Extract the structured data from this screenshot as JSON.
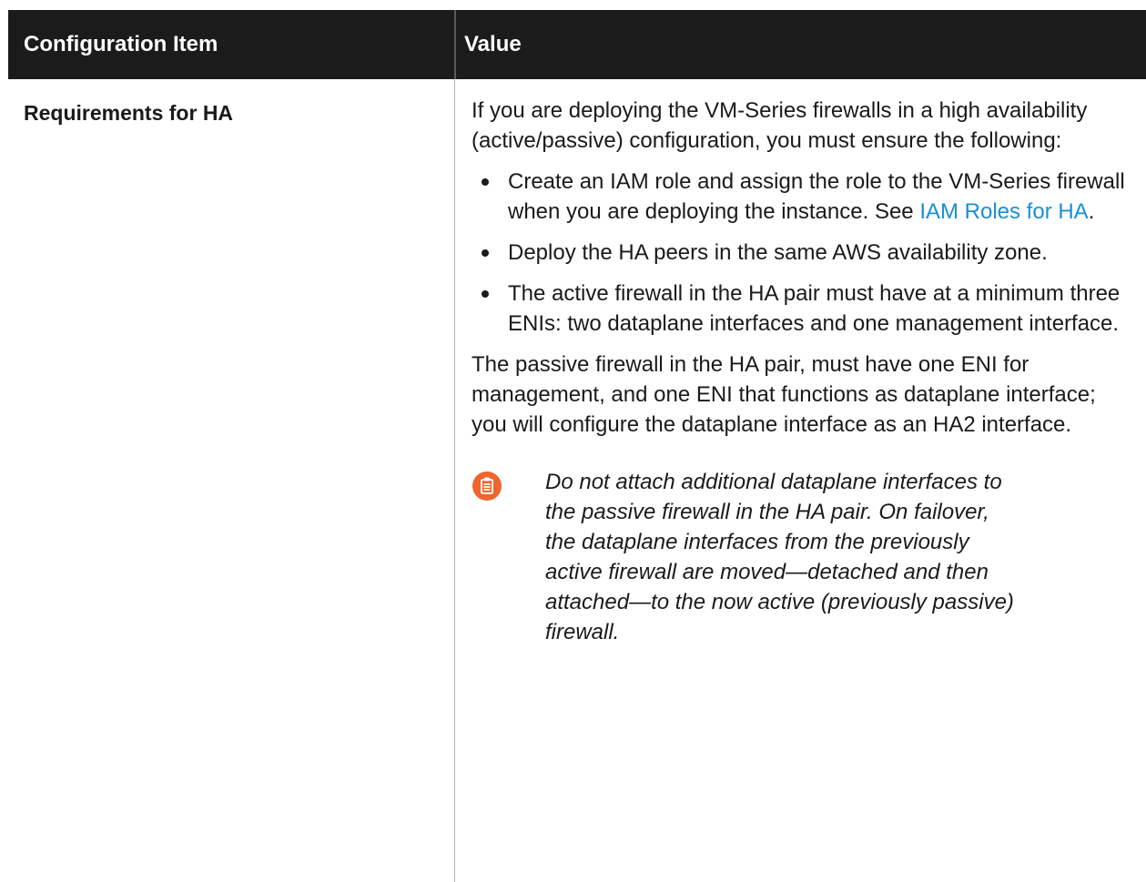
{
  "table": {
    "headers": {
      "item": "Configuration Item",
      "value": "Value"
    },
    "row": {
      "item": "Requirements for HA",
      "intro": "If you are deploying the VM-Series firewalls in a high availability (active/passive) configuration, you must ensure the following:",
      "bullets": {
        "b1_text": "Create an IAM role and assign the role to the VM-Series firewall when you are deploying the instance. See ",
        "b1_link": "IAM Roles for HA",
        "b1_end": ".",
        "b2": "Deploy the HA peers in the same AWS availability zone.",
        "b3": "The active firewall in the HA pair must have at a minimum three ENIs: two dataplane interfaces and one management interface."
      },
      "passive": "The passive firewall in the HA pair, must have one ENI for management, and one ENI that functions as dataplane interface; you will configure the dataplane interface as an HA2 interface.",
      "note": "Do not attach additional dataplane interfaces to the passive firewall in the HA pair. On failover, the dataplane interfaces from the previously active firewall are moved—detached and then attached—to the now active (previously passive) firewall.",
      "note_icon": "clipboard-note-icon"
    }
  },
  "colors": {
    "header_bg": "#1b1b1b",
    "link": "#1a8fd6",
    "note_icon": "#f0642d"
  }
}
